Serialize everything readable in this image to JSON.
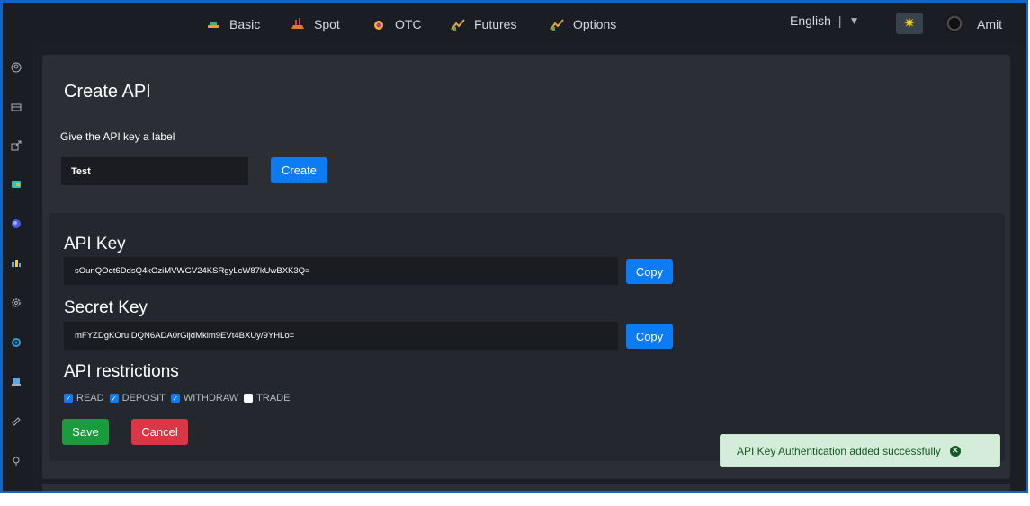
{
  "nav": {
    "items": [
      {
        "label": "Basic",
        "icon": "basic-icon"
      },
      {
        "label": "Spot",
        "icon": "spot-icon"
      },
      {
        "label": "OTC",
        "icon": "otc-icon"
      },
      {
        "label": "Futures",
        "icon": "futures-icon"
      },
      {
        "label": "Options",
        "icon": "options-icon"
      }
    ],
    "language": "English",
    "language_sep": "|",
    "language_caret": "▼",
    "theme_icon": "✷",
    "user": "Amit"
  },
  "sidebar": {
    "icons": [
      "user-circle-icon",
      "card-icon",
      "export-icon",
      "wallet-icon",
      "globe-icon",
      "chart-icon",
      "gear-icon",
      "target-icon",
      "laptop-icon",
      "tag-icon",
      "pin-icon"
    ]
  },
  "create": {
    "title": "Create API",
    "prompt": "Give the API key a label",
    "input_value": "Test",
    "button": "Create"
  },
  "keys": {
    "api_title": "API Key",
    "api_value": "sOunQOot6DdsQ4kOziMVWGV24KSRgyLcW87kUwBXK3Q=",
    "secret_title": "Secret Key",
    "secret_value": "mFYZDgKOruIDQN6ADA0rGijdMklm9EVt4BXUy/9YHLo=",
    "copy_label": "Copy",
    "copy_label_2": "Copy"
  },
  "restrictions": {
    "title": "API restrictions",
    "items": [
      {
        "label": "READ",
        "checked": true
      },
      {
        "label": "DEPOSIT",
        "checked": true
      },
      {
        "label": "WITHDRAW",
        "checked": true
      },
      {
        "label": "TRADE",
        "checked": false
      }
    ]
  },
  "actions": {
    "save": "Save",
    "cancel": "Cancel"
  },
  "toast": {
    "message": "API Key Authentication added successfully",
    "close_icon": "✕"
  },
  "colors": {
    "accent": "#0d7cf2",
    "success": "#1a9b3c",
    "danger": "#dc3545",
    "toast_bg": "#d4edda"
  }
}
